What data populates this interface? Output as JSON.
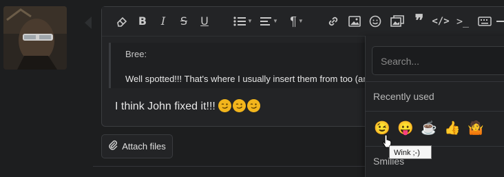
{
  "quote": {
    "author": "Bree:",
    "text": "Well spotted!!! That's where I usually insert them from too (and"
  },
  "message": {
    "text": "I think John fixed it!!!",
    "inline_emojis": [
      "wink",
      "wink",
      "wink"
    ]
  },
  "attach": {
    "label": "Attach files"
  },
  "emoji_panel": {
    "search_placeholder": "Search...",
    "recent_title": "Recently used",
    "recent": [
      {
        "name": "wink",
        "glyph": "😉"
      },
      {
        "name": "tongue",
        "glyph": "😛"
      },
      {
        "name": "coffee",
        "glyph": "☕"
      },
      {
        "name": "thumbs-up",
        "glyph": "👍"
      },
      {
        "name": "shrug",
        "glyph": "🤷"
      }
    ],
    "smilies_title": "Smilies"
  },
  "tooltip": {
    "text": "Wink   ;-)"
  },
  "toolbar": {
    "icons": [
      "eraser-icon",
      "bold-icon",
      "italic-icon",
      "strikethrough-icon",
      "underline-icon",
      "list-icon",
      "align-icon",
      "paragraph-icon",
      "link-icon",
      "image-icon",
      "emoji-icon",
      "media-icon",
      "quote-icon",
      "code-icon",
      "inline-code-icon",
      "keyboard-icon",
      "more-icon"
    ]
  },
  "colors": {
    "background": "#1d1e1f",
    "panel": "#212224",
    "accent": "#f2b51c"
  }
}
